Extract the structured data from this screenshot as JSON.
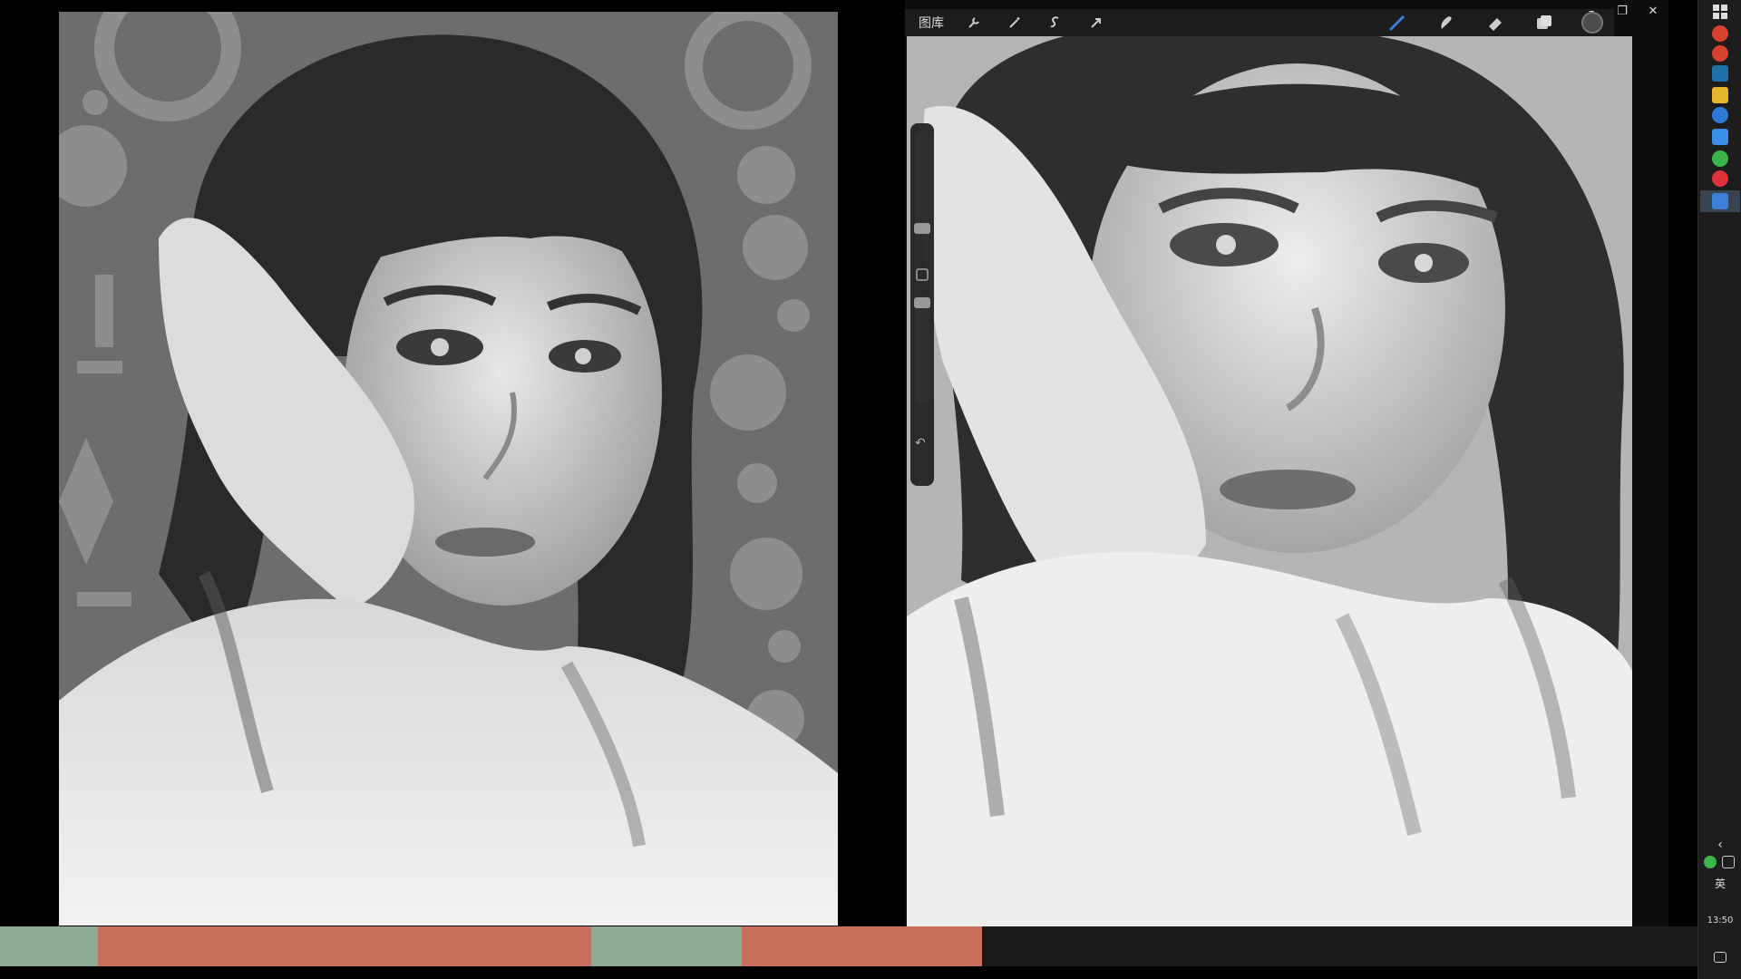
{
  "procreate": {
    "gallery_label": "图库",
    "toolbar_left_icons": [
      "wrench-icon",
      "magic-wand-icon",
      "selection-icon",
      "transform-arrow-icon"
    ],
    "toolbar_right_icons": [
      "brush-icon",
      "smudge-icon",
      "eraser-icon",
      "layers-icon"
    ],
    "active_color": "#4b4b4b",
    "brush_accent": "#3d7fd9"
  },
  "window_controls": {
    "minimize": "–",
    "restore": "❐",
    "close": "✕"
  },
  "taskbar": {
    "language": "英",
    "time": "13:50",
    "chevron": "‹"
  },
  "stripe_colors": [
    "#8caa94",
    "#c86f5c",
    "#8caa94",
    "#c86f5c",
    "#1b1b1b"
  ]
}
